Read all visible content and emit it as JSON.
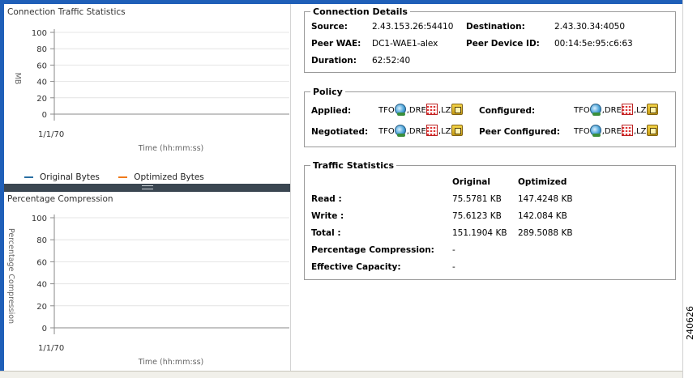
{
  "charts": {
    "traffic": {
      "title": "Connection Traffic Statistics",
      "ylabel": "MB",
      "xlabel": "Time (hh:mm:ss)",
      "yticks": [
        "100",
        "80",
        "60",
        "40",
        "20",
        "0"
      ],
      "xtick": "1/1/70",
      "legend": [
        {
          "label": "Original Bytes",
          "color": "#2a6fa3"
        },
        {
          "label": "Optimized Bytes",
          "color": "#f07a1a"
        }
      ]
    },
    "compression": {
      "title": "Percentage Compression",
      "ylabel": "Percentage Compression",
      "xlabel": "Time (hh:mm:ss)",
      "yticks": [
        "100",
        "80",
        "60",
        "40",
        "20",
        "0"
      ],
      "xtick": "1/1/70"
    }
  },
  "chart_data": [
    {
      "type": "line",
      "title": "Connection Traffic Statistics",
      "xlabel": "Time (hh:mm:ss)",
      "ylabel": "MB",
      "ylim": [
        0,
        100
      ],
      "x": [
        "1/1/70"
      ],
      "series": [
        {
          "name": "Original Bytes",
          "values": []
        },
        {
          "name": "Optimized Bytes",
          "values": []
        }
      ],
      "grid": true,
      "legend": "bottom"
    },
    {
      "type": "line",
      "title": "Percentage Compression",
      "xlabel": "Time (hh:mm:ss)",
      "ylabel": "Percentage Compression",
      "ylim": [
        0,
        100
      ],
      "x": [
        "1/1/70"
      ],
      "series": [],
      "grid": true
    }
  ],
  "connection_details": {
    "title": "Connection Details",
    "source_label": "Source:",
    "source_value": "2.43.153.26:54410",
    "destination_label": "Destination:",
    "destination_value": "2.43.30.34:4050",
    "peer_wae_label": "Peer WAE:",
    "peer_wae_value": "DC1-WAE1-alex",
    "peer_device_id_label": "Peer Device ID:",
    "peer_device_id_value": "00:14:5e:95:c6:63",
    "duration_label": "Duration:",
    "duration_value": "62:52:40"
  },
  "policy": {
    "title": "Policy",
    "applied_label": "Applied:",
    "configured_label": "Configured:",
    "negotiated_label": "Negotiated:",
    "peer_configured_label": "Peer Configured:",
    "tfo": "TFO",
    "dre": ",DRE",
    "lz": ",LZ"
  },
  "traffic_statistics": {
    "title": "Traffic Statistics",
    "col_original": "Original",
    "col_optimized": "Optimized",
    "rows": [
      {
        "label": "Read :",
        "original": "75.5781 KB",
        "optimized": "147.4248 KB"
      },
      {
        "label": "Write :",
        "original": "75.6123 KB",
        "optimized": "142.084 KB"
      },
      {
        "label": "Total :",
        "original": "151.1904 KB",
        "optimized": "289.5088 KB"
      },
      {
        "label": "Percentage Compression:",
        "original": "-",
        "optimized": ""
      },
      {
        "label": "Effective Capacity:",
        "original": "-",
        "optimized": ""
      }
    ]
  },
  "figure_id": "240626"
}
